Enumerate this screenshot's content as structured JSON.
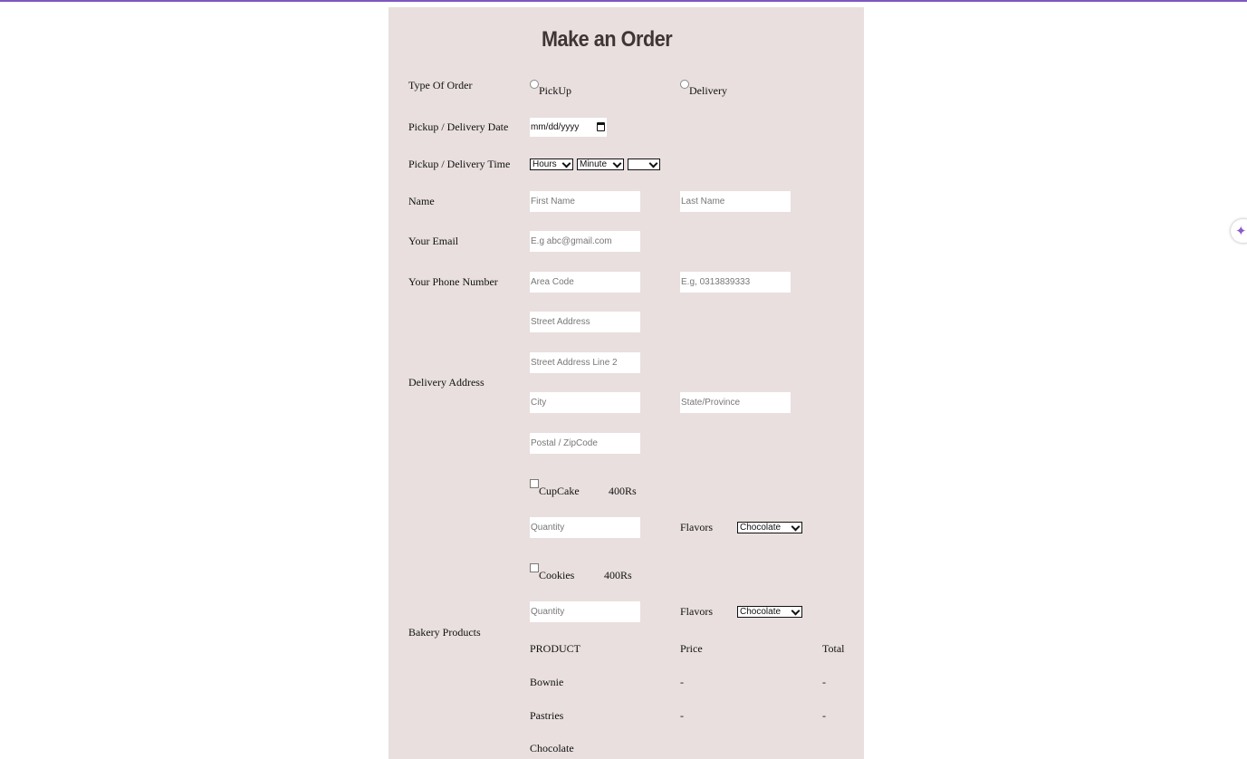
{
  "page": {
    "accent_color": "#7e57c2",
    "panel_color": "#e8dfde"
  },
  "form": {
    "title": "Make an Order",
    "order_type": {
      "label": "Type Of Order",
      "options": [
        "PickUp",
        "Delivery"
      ]
    },
    "date": {
      "label": "Pickup / Delivery Date",
      "value": "mm/dd/yyyy"
    },
    "time": {
      "label": "Pickup / Delivery Time",
      "hours": "Hours",
      "minute": "Minute",
      "ampm": ""
    },
    "name": {
      "label": "Name",
      "first_placeholder": "First Name",
      "last_placeholder": "Last Name"
    },
    "email": {
      "label": "Your Email",
      "placeholder": "E.g abc@gmail.com"
    },
    "phone": {
      "label": "Your Phone Number",
      "area_placeholder": "Area Code",
      "number_placeholder": "E.g, 0313839333"
    },
    "address": {
      "label": "Delivery Address",
      "street_placeholder": "Street Address",
      "street2_placeholder": "Street Address Line 2",
      "city_placeholder": "City",
      "state_placeholder": "State/Province",
      "postal_placeholder": "Postal / ZipCode"
    },
    "bakery": {
      "label": "Bakery Products",
      "items": [
        {
          "name": "CupCake",
          "price": "400Rs",
          "quantity_placeholder": "Quantity",
          "flavor_label": "Flavors",
          "flavor_value": "Chocolate"
        },
        {
          "name": "Cookies",
          "price": "400Rs",
          "quantity_placeholder": "Quantity",
          "flavor_label": "Flavors",
          "flavor_value": "Chocolate"
        }
      ],
      "table": {
        "headers": [
          "PRODUCT",
          "Price",
          "Total"
        ],
        "rows": [
          {
            "product": "Bownie",
            "price": "-",
            "total": "-"
          },
          {
            "product": "Pastries",
            "price": "-",
            "total": "-"
          },
          {
            "product": "Chocolate",
            "price": "",
            "total": ""
          }
        ]
      }
    }
  },
  "ai_button": {
    "icon": "sparkle-icon",
    "glyph": "✦"
  }
}
